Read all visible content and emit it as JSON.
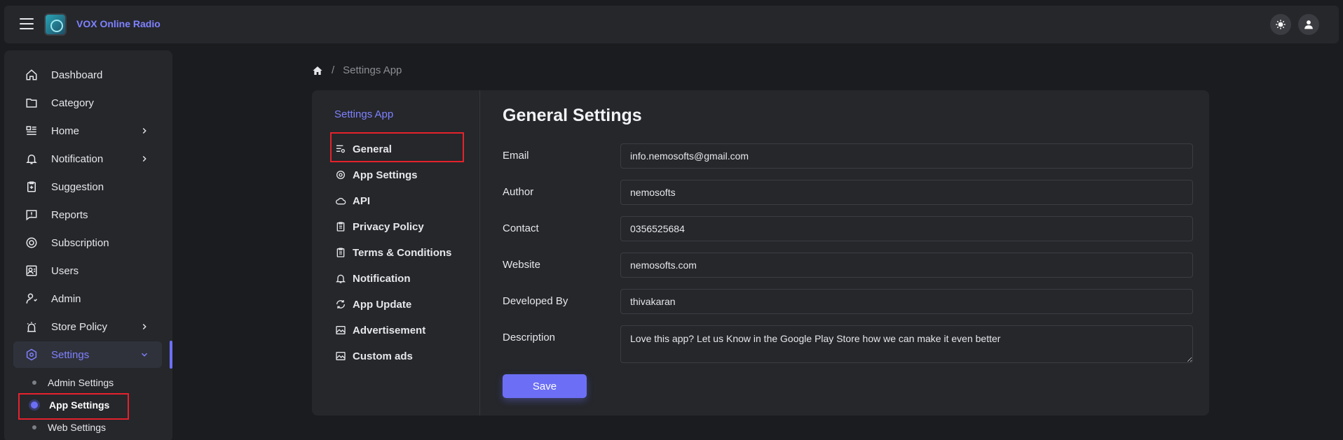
{
  "header": {
    "app_name": "VOX Online Radio",
    "menu_icon": "hamburger-icon",
    "theme_icon": "sun-icon",
    "profile_icon": "user-icon"
  },
  "sidebar": {
    "items": [
      {
        "label": "Dashboard",
        "icon": "home-icon"
      },
      {
        "label": "Category",
        "icon": "folder-icon"
      },
      {
        "label": "Home",
        "icon": "layout-icon"
      },
      {
        "label": "Notification",
        "icon": "bell-icon"
      },
      {
        "label": "Suggestion",
        "icon": "clipboard-plus-icon"
      },
      {
        "label": "Reports",
        "icon": "report-icon"
      },
      {
        "label": "Subscription",
        "icon": "subscription-icon"
      },
      {
        "label": "Users",
        "icon": "users-icon"
      },
      {
        "label": "Admin",
        "icon": "admin-icon"
      },
      {
        "label": "Store Policy",
        "icon": "store-icon"
      },
      {
        "label": "Settings",
        "icon": "settings-icon"
      }
    ],
    "sub_items": [
      {
        "label": "Admin Settings"
      },
      {
        "label": "App Settings"
      },
      {
        "label": "Web Settings"
      }
    ]
  },
  "breadcrumb": {
    "home_icon": "home-icon",
    "separator": "/",
    "current": "Settings App"
  },
  "settings_nav": {
    "title": "Settings App",
    "tabs": [
      {
        "label": "General",
        "icon": "sliders-icon"
      },
      {
        "label": "App Settings",
        "icon": "gear-icon"
      },
      {
        "label": "API",
        "icon": "cloud-icon"
      },
      {
        "label": "Privacy Policy",
        "icon": "document-icon"
      },
      {
        "label": "Terms & Conditions",
        "icon": "document-icon"
      },
      {
        "label": "Notification",
        "icon": "bell-icon"
      },
      {
        "label": "App Update",
        "icon": "refresh-icon"
      },
      {
        "label": "Advertisement",
        "icon": "image-icon"
      },
      {
        "label": "Custom ads",
        "icon": "image-icon"
      }
    ]
  },
  "panel": {
    "title": "General Settings",
    "fields": [
      {
        "label": "Email",
        "value": "info.nemosofts@gmail.com"
      },
      {
        "label": "Author",
        "value": "nemosofts"
      },
      {
        "label": "Contact",
        "value": "0356525684"
      },
      {
        "label": "Website",
        "value": "nemosofts.com"
      },
      {
        "label": "Developed By",
        "value": "thivakaran"
      },
      {
        "label": "Description",
        "value": "Love this app? Let us Know in the Google Play Store how we can make it even better"
      }
    ],
    "save_label": "Save"
  },
  "colors": {
    "accent": "#6c6ff5",
    "highlight": "#e5222c",
    "background": "#1b1c1f",
    "surface": "#25272b"
  }
}
